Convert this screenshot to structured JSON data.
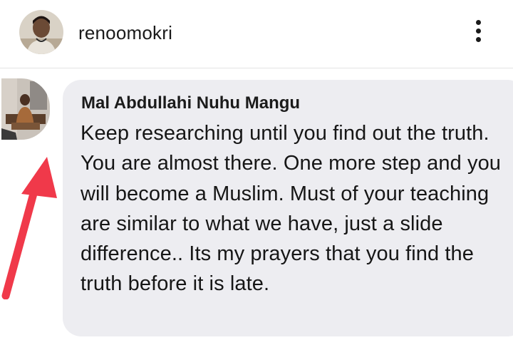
{
  "header": {
    "username": "renoomokri"
  },
  "comment": {
    "author": "Mal Abdullahi Nuhu Mangu",
    "text": "Keep researching until you find out the truth. You are almost there. One more step and you will become a Muslim. Must of your teaching are similar to what we have, just a slide difference.. Its my prayers that you find the truth before it is late."
  },
  "colors": {
    "bubble": "#ededf1",
    "arrow": "#f0394a",
    "divider": "#e3e3e3"
  },
  "icons": {
    "more": "vertical-ellipsis-icon",
    "annotation": "red-arrow-icon"
  }
}
